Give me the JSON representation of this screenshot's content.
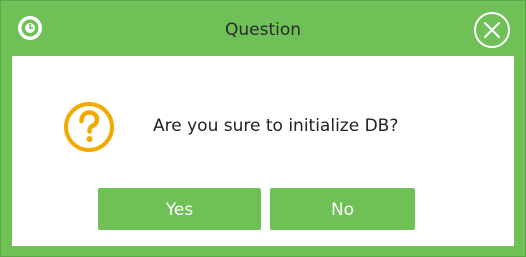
{
  "dialog": {
    "title": "Question",
    "message": "Are you sure to initialize DB?",
    "icon": "question-icon",
    "buttons": {
      "yes": "Yes",
      "no": "No"
    }
  },
  "colors": {
    "accent": "#6ec057",
    "question_icon": "#f2a900",
    "text": "#222222",
    "button_text": "#ffffff"
  }
}
